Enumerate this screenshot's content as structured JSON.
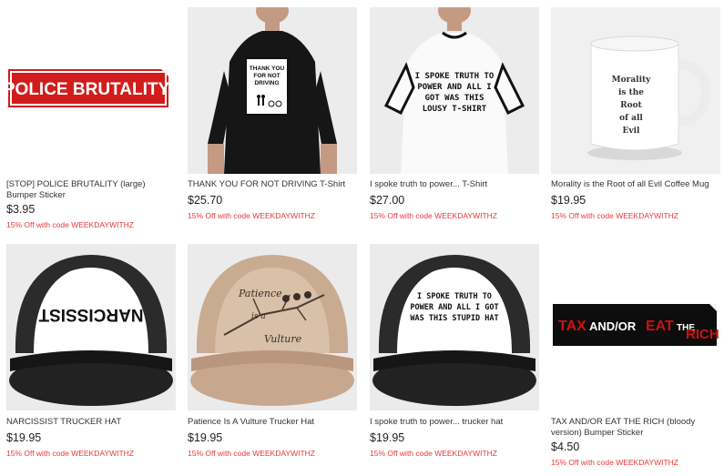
{
  "products": [
    {
      "title": "[STOP] POLICE BRUTALITY (large) Bumper Sticker",
      "price": "$3.95",
      "promo": "15% Off with code WEEKDAYWITHZ",
      "art": "POLICE BRUTALITY"
    },
    {
      "title": "THANK YOU FOR NOT DRIVING T-Shirt",
      "price": "$25.70",
      "promo": "15% Off with code WEEKDAYWITHZ",
      "art": "THANK YOU FOR NOT DRIVING"
    },
    {
      "title": "I spoke truth to power... T-Shirt",
      "price": "$27.00",
      "promo": "15% Off with code WEEKDAYWITHZ",
      "art": "I SPOKE TRUTH TO POWER AND ALL I GOT WAS THIS LOUSY T-SHIRT"
    },
    {
      "title": "Morality is the Root of all Evil Coffee Mug",
      "price": "$19.95",
      "promo": "15% Off with code WEEKDAYWITHZ",
      "art": "Morality is the Root of all Evil"
    },
    {
      "title": "NARCISSIST TRUCKER HAT",
      "price": "$19.95",
      "promo": "15% Off with code WEEKDAYWITHZ",
      "art": "NARCISSIST"
    },
    {
      "title": "Patience Is A Vulture Trucker Hat",
      "price": "$19.95",
      "promo": "15% Off with code WEEKDAYWITHZ",
      "art": "Patience is a Vulture"
    },
    {
      "title": "I spoke truth to power... trucker hat",
      "price": "$19.95",
      "promo": "15% Off with code WEEKDAYWITHZ",
      "art": "I SPOKE TRUTH TO POWER AND ALL I GOT WAS THIS STUPID HAT"
    },
    {
      "title": "TAX AND/OR EAT THE RICH (bloody version) Bumper Sticker",
      "price": "$4.50",
      "promo": "15% Off with code WEEKDAYWITHZ",
      "art": "TAX AND/OR EAT THE RICH"
    }
  ],
  "colors": {
    "promo": "#e8383d",
    "sticker_red": "#d21c1c",
    "text": "#333333"
  }
}
